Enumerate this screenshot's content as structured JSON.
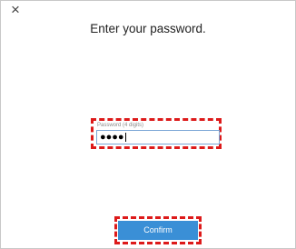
{
  "dialog": {
    "close_glyph": "×",
    "title": "Enter your password."
  },
  "password": {
    "placeholder": "Password (4 digits)",
    "masked_value": "●●●●"
  },
  "confirm": {
    "label": "Confirm"
  },
  "colors": {
    "highlight": "#dd1a1a",
    "button": "#3a8fd6",
    "field_border": "#7aa6d6"
  }
}
